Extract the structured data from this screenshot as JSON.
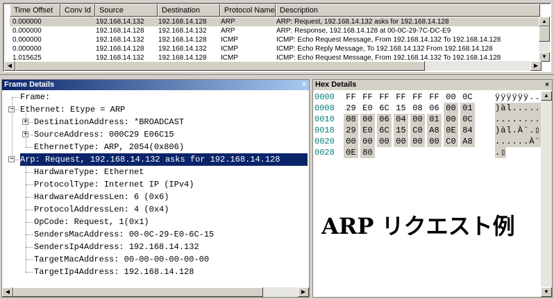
{
  "packet_list": {
    "columns": [
      "Time Offset",
      "Conv Id",
      "Source",
      "Destination",
      "Protocol Name",
      "Description"
    ],
    "rows": [
      {
        "time": "0.000000",
        "conv": "",
        "source": "192.168.14.132",
        "destination": "192.168.14.128",
        "protocol": "ARP",
        "description": "ARP: Request, 192.168.14.132 asks for 192.168.14.128"
      },
      {
        "time": "0.000000",
        "conv": "",
        "source": "192.168.14.128",
        "destination": "192.168.14.132",
        "protocol": "ARP",
        "description": "ARP: Response, 192.168.14.128 at 00-0C-29-7C-DC-E9"
      },
      {
        "time": "0.000000",
        "conv": "",
        "source": "192.168.14.132",
        "destination": "192.168.14.128",
        "protocol": "ICMP",
        "description": "ICMP: Echo Request Message, From 192.168.14.132 To 192.168.14.128"
      },
      {
        "time": "0.000000",
        "conv": "",
        "source": "192.168.14.128",
        "destination": "192.168.14.132",
        "protocol": "ICMP",
        "description": "ICMP: Echo Reply Message, To 192.168.14.132 From 192.168.14.128"
      },
      {
        "time": "1.015625",
        "conv": "",
        "source": "192.168.14.132",
        "destination": "192.168.14.128",
        "protocol": "ICMP",
        "description": "ICMP: Echo Request Message, From 192.168.14.132 To 192.168.14.128"
      }
    ]
  },
  "frame_details": {
    "title": "Frame Details",
    "close": "×",
    "tree": [
      {
        "text": "Frame:",
        "level": 0,
        "expander": ""
      },
      {
        "text": "Ethernet: Etype = ARP",
        "level": 0,
        "expander": "−"
      },
      {
        "text": "DestinationAddress: *BROADCAST",
        "level": 1,
        "expander": "+"
      },
      {
        "text": "SourceAddress: 000C29 E06C15",
        "level": 1,
        "expander": "+"
      },
      {
        "text": "EthernetType: ARP, 2054(0x806)",
        "level": 1,
        "expander": ""
      },
      {
        "text": "Arp: Request, 192.168.14.132 asks for 192.168.14.128",
        "level": 0,
        "expander": "−",
        "selected": true
      },
      {
        "text": "HardwareType: Ethernet",
        "level": 1,
        "expander": ""
      },
      {
        "text": "ProtocolType: Internet IP (IPv4)",
        "level": 1,
        "expander": ""
      },
      {
        "text": "HardwareAddressLen: 6 (0x6)",
        "level": 1,
        "expander": ""
      },
      {
        "text": "ProtocolAddressLen: 4 (0x4)",
        "level": 1,
        "expander": ""
      },
      {
        "text": "OpCode: Request, 1(0x1)",
        "level": 1,
        "expander": ""
      },
      {
        "text": "SendersMacAddress: 00-0C-29-E0-6C-15",
        "level": 1,
        "expander": ""
      },
      {
        "text": "SendersIp4Address: 192.168.14.132",
        "level": 1,
        "expander": ""
      },
      {
        "text": "TargetMacAddress: 00-00-00-00-00-00",
        "level": 1,
        "expander": ""
      },
      {
        "text": "TargetIp4Address: 192.168.14.128",
        "level": 1,
        "expander": ""
      }
    ]
  },
  "hex_details": {
    "title": "Hex Details",
    "close": "×",
    "rows": [
      {
        "offset": "0000",
        "bytes": [
          "FF",
          "FF",
          "FF",
          "FF",
          "FF",
          "FF",
          "00",
          "0C"
        ],
        "hl_from": 8,
        "ascii": "ÿÿÿÿÿÿ..",
        "ascii_hl": false
      },
      {
        "offset": "0008",
        "bytes": [
          "29",
          "E0",
          "6C",
          "15",
          "08",
          "06",
          "00",
          "01"
        ],
        "hl_from": 6,
        "ascii": ")àl.....",
        "ascii_hl": true
      },
      {
        "offset": "0010",
        "bytes": [
          "08",
          "00",
          "06",
          "04",
          "00",
          "01",
          "00",
          "0C"
        ],
        "hl_from": 0,
        "ascii": "........",
        "ascii_hl": true
      },
      {
        "offset": "0018",
        "bytes": [
          "29",
          "E0",
          "6C",
          "15",
          "C0",
          "A8",
          "0E",
          "84"
        ],
        "hl_from": 0,
        "ascii": ")àl.À¨.▯",
        "ascii_hl": true
      },
      {
        "offset": "0020",
        "bytes": [
          "00",
          "00",
          "00",
          "00",
          "00",
          "00",
          "C0",
          "A8"
        ],
        "hl_from": 0,
        "ascii": "......À¨",
        "ascii_hl": true
      },
      {
        "offset": "0028",
        "bytes": [
          "0E",
          "80"
        ],
        "hl_from": 0,
        "ascii": ".▯",
        "ascii_hl": true
      }
    ]
  },
  "caption": "ARP リクエスト例"
}
